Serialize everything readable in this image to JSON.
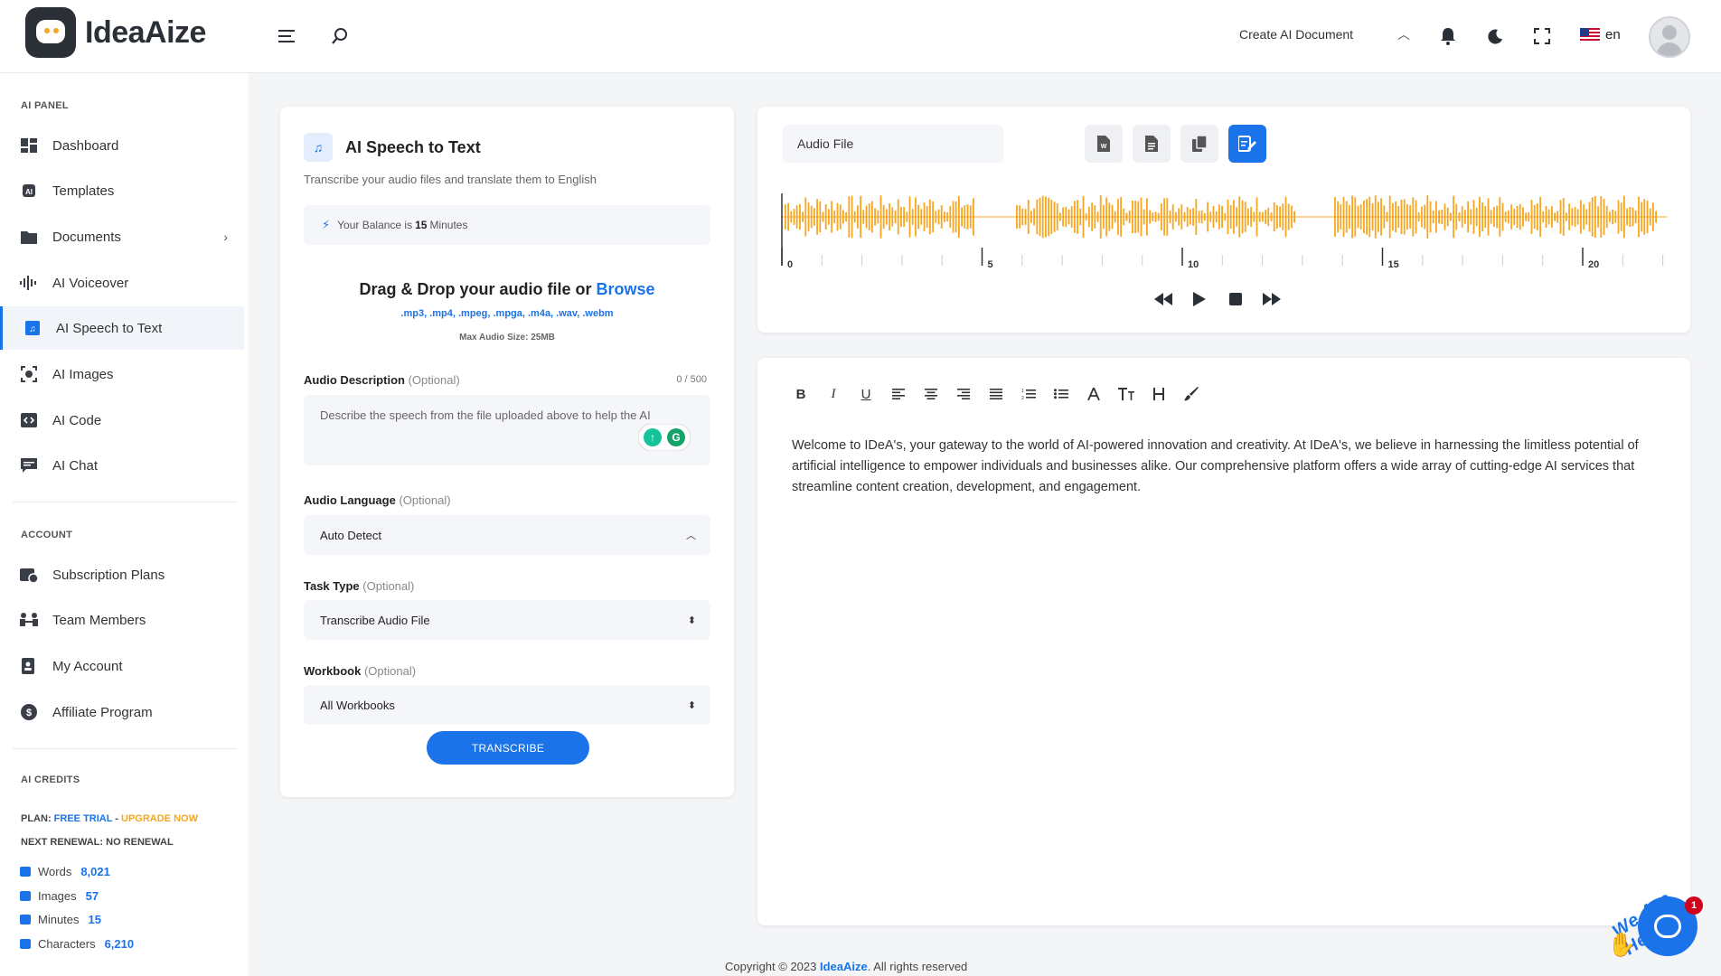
{
  "header": {
    "brand": "IdeaAize",
    "create_doc": "Create AI Document",
    "lang": "en"
  },
  "sidebar": {
    "ai_panel_title": "AI PANEL",
    "ai_items": [
      {
        "label": "Dashboard",
        "icon": "dashboard-icon"
      },
      {
        "label": "Templates",
        "icon": "templates-icon"
      },
      {
        "label": "Documents",
        "icon": "folder-icon"
      },
      {
        "label": "AI Voiceover",
        "icon": "waveform-icon"
      },
      {
        "label": "AI Speech to Text",
        "icon": "audio-file-icon"
      },
      {
        "label": "AI Images",
        "icon": "image-scan-icon"
      },
      {
        "label": "AI Code",
        "icon": "code-icon"
      },
      {
        "label": "AI Chat",
        "icon": "chat-icon"
      }
    ],
    "account_title": "ACCOUNT",
    "account_items": [
      {
        "label": "Subscription Plans",
        "icon": "subscription-icon"
      },
      {
        "label": "Team Members",
        "icon": "team-icon"
      },
      {
        "label": "My Account",
        "icon": "account-icon"
      },
      {
        "label": "Affiliate Program",
        "icon": "dollar-icon"
      }
    ],
    "credits_title": "AI CREDITS",
    "plan_label": "PLAN:",
    "plan_value": "FREE TRIAL",
    "plan_sep": " - ",
    "upgrade": "UPGRADE NOW",
    "renewal_label": "NEXT RENEWAL:",
    "renewal_value": "NO RENEWAL",
    "credits": [
      {
        "label": "Words",
        "value": "8,021"
      },
      {
        "label": "Images",
        "value": "57"
      },
      {
        "label": "Minutes",
        "value": "15"
      },
      {
        "label": "Characters",
        "value": "6,210"
      }
    ]
  },
  "speech": {
    "title": "AI Speech to Text",
    "subtitle": "Transcribe your audio files and translate them to English",
    "balance_prefix": "Your Balance is",
    "balance_value": "15",
    "balance_suffix": "Minutes",
    "drop_title": "Drag & Drop your audio file or",
    "browse": "Browse",
    "formats": ".mp3, .mp4, .mpeg, .mpga, .m4a, .wav, .webm",
    "max_size": "Max Audio Size: 25MB",
    "desc_label": "Audio Description",
    "optional": "(Optional)",
    "desc_counter": "0 / 500",
    "desc_placeholder": "Describe the speech from the file uploaded above to help the AI",
    "lang_label": "Audio Language",
    "lang_value": "Auto Detect",
    "task_label": "Task Type",
    "task_value": "Transcribe Audio File",
    "workbook_label": "Workbook",
    "workbook_value": "All Workbooks",
    "submit": "TRANSCRIBE"
  },
  "player": {
    "file_label": "Audio File",
    "ticks": [
      "0",
      "5",
      "10",
      "15",
      "20"
    ]
  },
  "editor": {
    "tools": [
      "B",
      "I",
      "U"
    ],
    "text": "Welcome to IDeA's, your gateway to the world of AI-powered innovation and creativity. At IDeA's, we believe in harnessing the limitless potential of artificial intelligence to empower individuals and businesses alike. Our comprehensive platform offers a wide array of cutting-edge AI services that streamline content creation, development, and engagement."
  },
  "footer": {
    "prefix": "Copyright © 2023",
    "brand": "IdeaAize",
    "suffix": ". All rights reserved"
  },
  "chat_widget": {
    "text": "We Are Here!",
    "badge": "1"
  }
}
